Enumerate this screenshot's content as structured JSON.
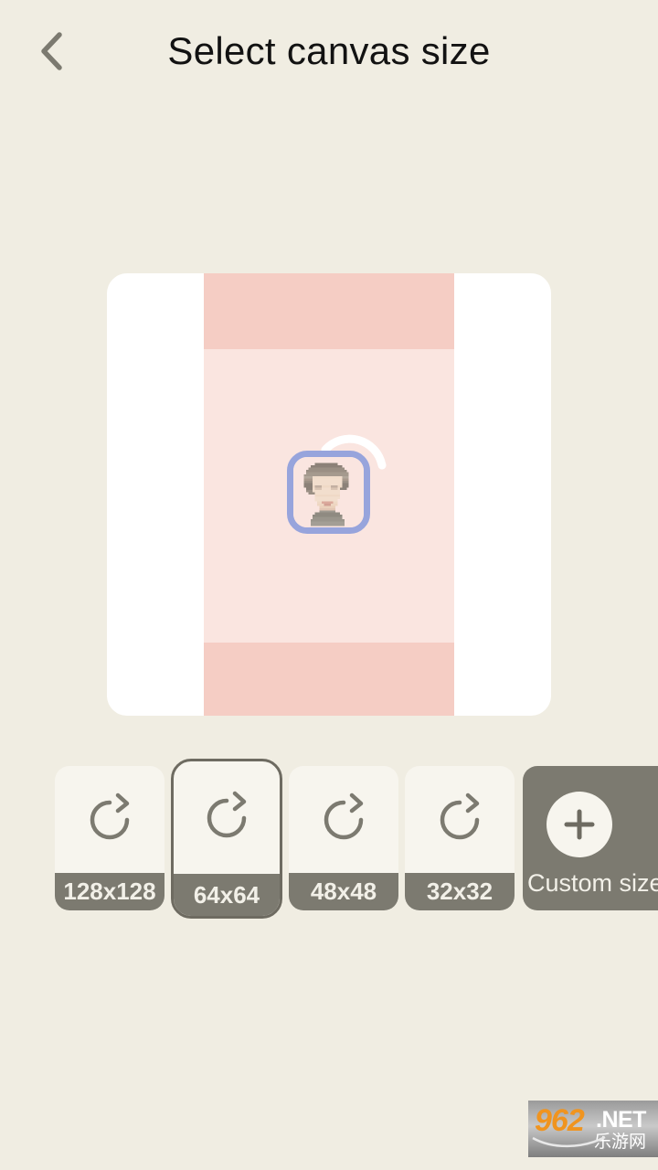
{
  "header": {
    "title": "Select canvas size",
    "back_icon": "chevron-left-icon",
    "back_label": "Back"
  },
  "canvas_preview": {
    "name": "canvas-preview",
    "card_color": "#FFFFFF",
    "band_dark_color": "#F5CDC4",
    "band_light_color": "#FAE5E0",
    "avatar_border_color": "#97A4DC",
    "loading_arc_color": "#FFFFFF",
    "avatar_icon": "pixel-art-portrait",
    "loading_icon": "loading-arc-icon"
  },
  "size_options": {
    "icon_name": "redo-arrow-icon",
    "selected_index": 1,
    "items": [
      {
        "label": "128x128",
        "selected": false
      },
      {
        "label": "64x64",
        "selected": true
      },
      {
        "label": "48x48",
        "selected": false
      },
      {
        "label": "32x32",
        "selected": false
      }
    ],
    "custom": {
      "label": "Custom size",
      "icon": "plus-icon",
      "clipped": true
    }
  },
  "watermark": {
    "number": "962",
    "domain": ".NET",
    "chinese": "乐游网"
  },
  "colors": {
    "background": "#F0EDE2",
    "card_face": "#F7F5EE",
    "label_bar": "#7C7A70",
    "selected_border": "#6E6B61",
    "title_text": "#121212",
    "icon_gray": "#7C7A70"
  }
}
